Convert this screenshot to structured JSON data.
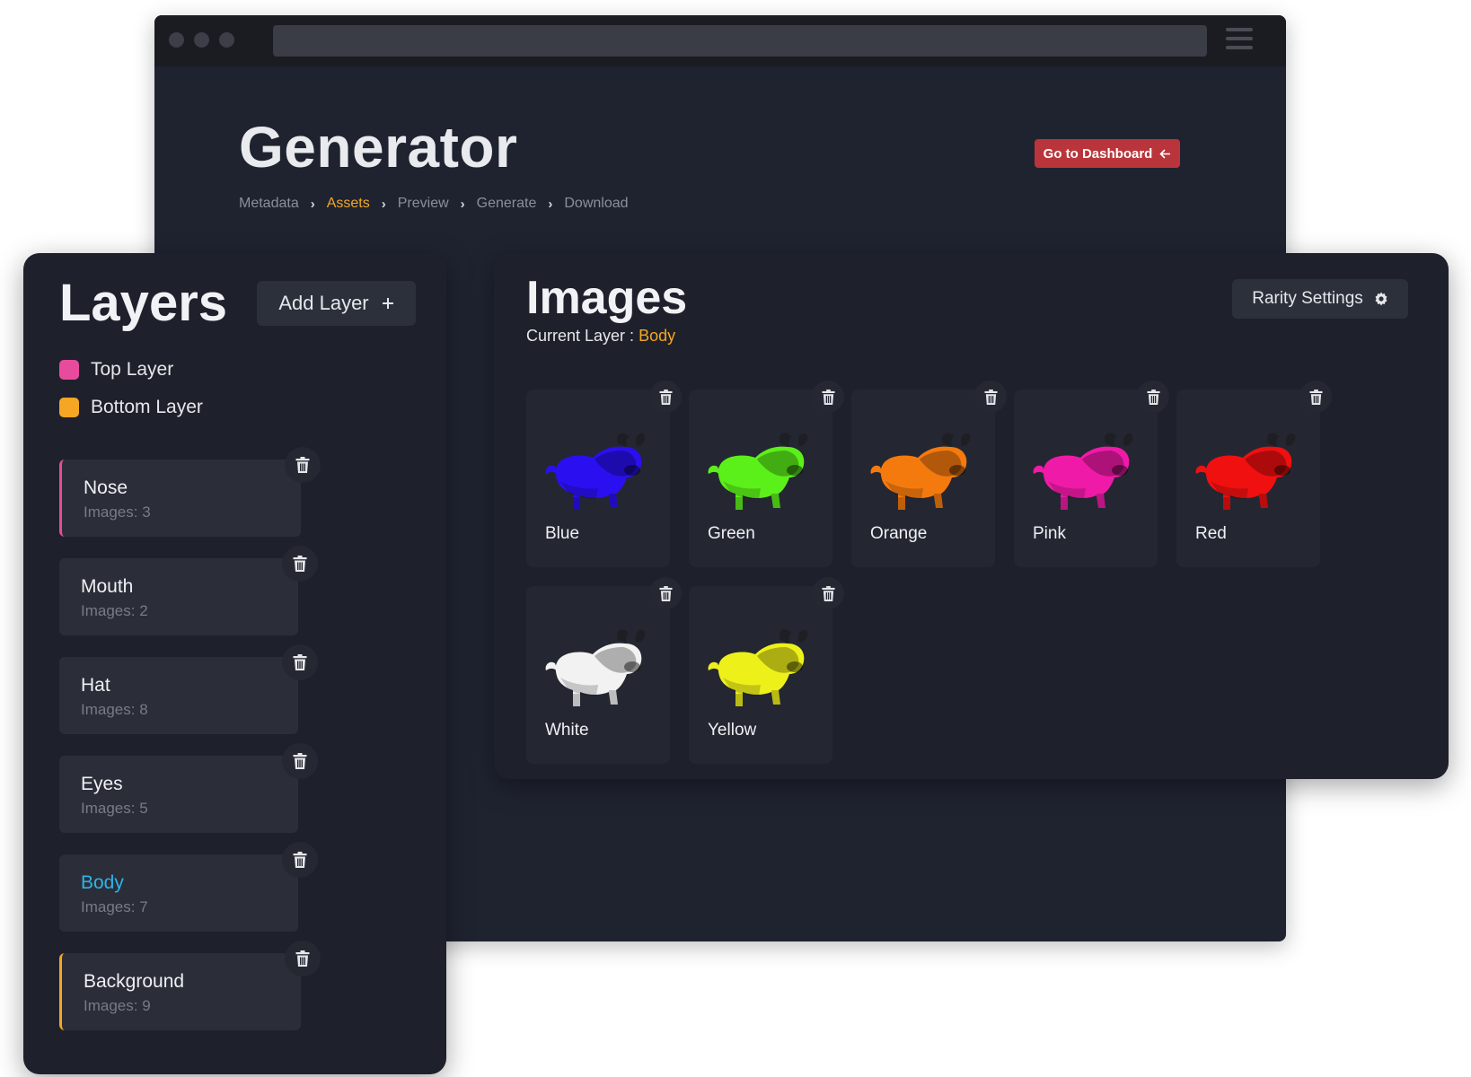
{
  "header": {
    "title": "Generator",
    "dashboard_button": "Go to Dashboard",
    "breadcrumb": [
      {
        "label": "Metadata",
        "active": false
      },
      {
        "label": "Assets",
        "active": true
      },
      {
        "label": "Preview",
        "active": false
      },
      {
        "label": "Generate",
        "active": false
      },
      {
        "label": "Download",
        "active": false
      }
    ]
  },
  "layers": {
    "title": "Layers",
    "add_button": "Add Layer",
    "legend": [
      {
        "label": "Top Layer",
        "color": "#e84b9c"
      },
      {
        "label": "Bottom Layer",
        "color": "#f5a623"
      }
    ],
    "items": [
      {
        "name": "Nose",
        "count": "Images: 3"
      },
      {
        "name": "Mouth",
        "count": "Images: 2"
      },
      {
        "name": "Hat",
        "count": "Images: 8"
      },
      {
        "name": "Eyes",
        "count": "Images: 5"
      },
      {
        "name": "Body",
        "count": "Images: 7"
      },
      {
        "name": "Background",
        "count": "Images: 9"
      }
    ]
  },
  "images": {
    "title": "Images",
    "current_layer_label": "Current Layer :",
    "current_layer_value": "Body",
    "rarity_button": "Rarity Settings",
    "items": [
      {
        "label": "Blue",
        "color": "#2a10f0"
      },
      {
        "label": "Green",
        "color": "#5cf01a"
      },
      {
        "label": "Orange",
        "color": "#f57a0e"
      },
      {
        "label": "Pink",
        "color": "#f01aa8"
      },
      {
        "label": "Red",
        "color": "#f01010"
      },
      {
        "label": "White",
        "color": "#f2f2f2"
      },
      {
        "label": "Yellow",
        "color": "#eef01a"
      }
    ]
  },
  "icons": [
    "trash-icon",
    "plus-icon",
    "gear-icon",
    "arrow-left-icon",
    "menu-icon"
  ],
  "colors": {
    "accent_orange": "#f5a623",
    "accent_pink": "#e84b9c",
    "selected_blue": "#2fb4e8",
    "dashboard_red": "#b9353b"
  }
}
